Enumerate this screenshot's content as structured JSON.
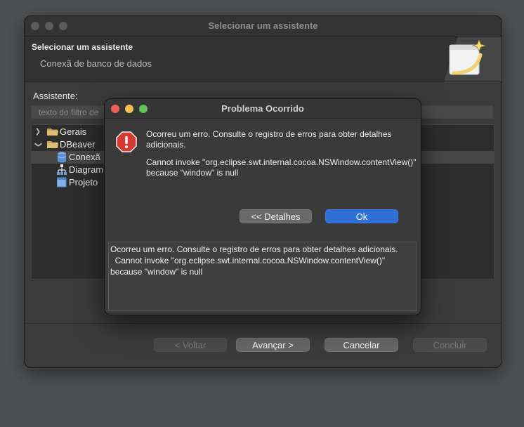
{
  "wizard": {
    "window_title": "Selecionar um assistente",
    "header_title": "Selecionar um assistente",
    "header_subtitle": "Conexã de banco de dados",
    "assistant_label": "Assistente:",
    "filter_placeholder": "texto do filtro de",
    "tree": [
      {
        "label": "Gerais",
        "icon": "folder-icon",
        "expanded": false
      },
      {
        "label": "DBeaver",
        "icon": "folder-icon",
        "expanded": true
      },
      {
        "label": "Conexã",
        "icon": "database-icon",
        "selected": true
      },
      {
        "label": "Diagram",
        "icon": "diagram-icon"
      },
      {
        "label": "Projeto",
        "icon": "project-icon"
      }
    ],
    "buttons": {
      "back": "< Voltar",
      "next": "Avançar >",
      "cancel": "Cancelar",
      "finish": "Concluir"
    }
  },
  "dialog": {
    "title": "Problema Ocorrido",
    "message": "Ocorreu um erro. Consulte o registro de erros para obter detalhes adicionais.",
    "detail": "Cannot invoke \"org.eclipse.swt.internal.cocoa.NSWindow.contentView()\" because \"window\" is null",
    "details_button": "<< Detalhes",
    "ok_button": "Ok",
    "details_text": "Ocorreu um erro. Consulte o registro de erros para obter detalhes adicionais.\n  Cannot invoke \"org.eclipse.swt.internal.cocoa.NSWindow.contentView()\" because \"window\" is null"
  },
  "colors": {
    "accent": "#2f6fd6",
    "error_icon": "#d63a32",
    "close_light": "#ec5f57",
    "minimize_light": "#f4bd4f",
    "zoom_light": "#60c454"
  }
}
